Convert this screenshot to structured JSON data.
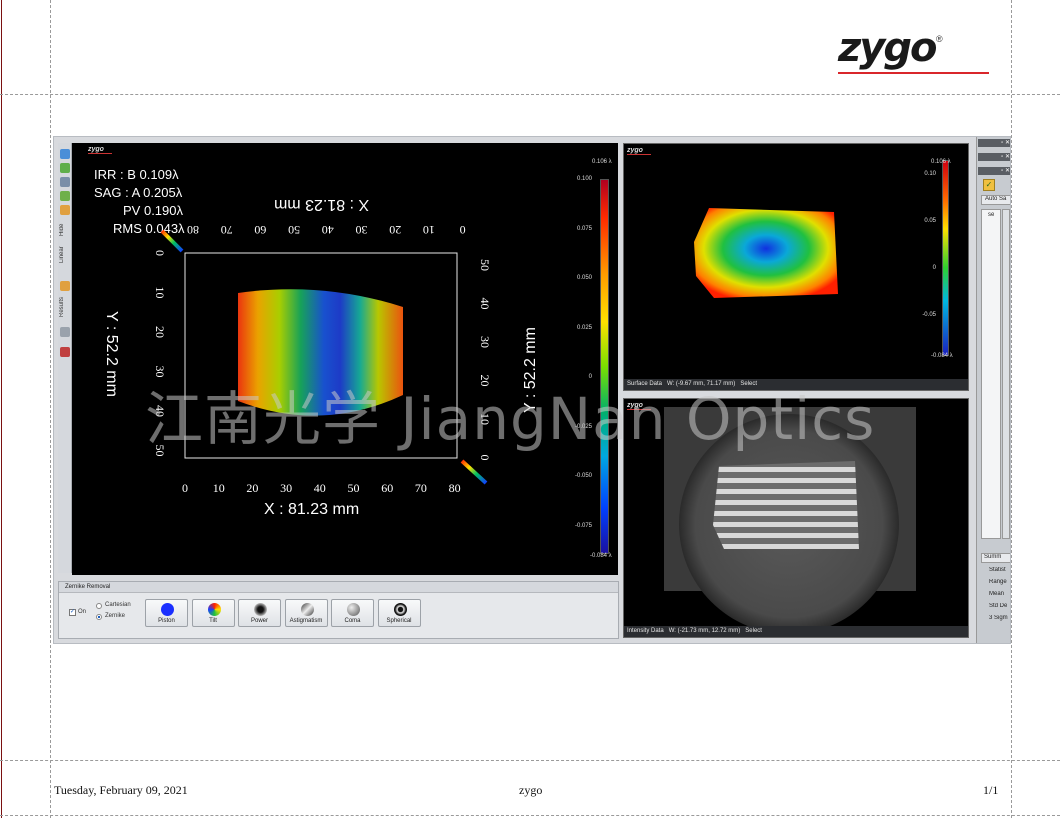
{
  "header": {
    "logo": "zygo",
    "logo_mark": "®",
    "logo_accent": "#d9262b"
  },
  "left_toolbar": {
    "tabs": [
      "Hide",
      "Linear",
      "Results"
    ]
  },
  "main_plot": {
    "mini_logo": "zygo",
    "stats": [
      {
        "label": "IRR : B",
        "value": "0.109λ"
      },
      {
        "label": "SAG : A",
        "value": "0.205λ"
      },
      {
        "label": "PV",
        "value": "0.190λ"
      },
      {
        "label": "RMS",
        "value": "0.043λ"
      }
    ],
    "x_axis_label": "X : 81.23 mm",
    "x_axis_label_mirrored": "X : 81.23 mm",
    "y_axis_label": "Y : 52.2 mm",
    "y_axis_label_right": "Y : 52.2 mm",
    "x_ticks": [
      "0",
      "10",
      "20",
      "30",
      "40",
      "50",
      "60",
      "70",
      "80"
    ],
    "x_ticks_top": [
      "80",
      "70",
      "60",
      "50",
      "40",
      "30",
      "20",
      "10",
      "0"
    ],
    "y_ticks_left": [
      "0",
      "10",
      "20",
      "30",
      "40",
      "50"
    ],
    "y_ticks_right": [
      "50",
      "40",
      "30",
      "20",
      "10",
      "0"
    ],
    "colorbar_top": "0.106 λ",
    "colorbar_bottom": "-0.084 λ",
    "colorbar_ticks": [
      "0.100",
      "0.075",
      "0.050",
      "0.025",
      "0",
      "-0.025",
      "-0.050",
      "-0.075"
    ]
  },
  "zernike_panel": {
    "title": "Zernike Removal",
    "on_label": "On",
    "on_checked": true,
    "mode_options": [
      "Cartesian",
      "Zernike"
    ],
    "mode_selected": "Zernike",
    "terms": [
      {
        "label": "Piston",
        "icon": "piston-icon"
      },
      {
        "label": "Tilt",
        "icon": "tilt-icon"
      },
      {
        "label": "Power",
        "icon": "power-icon"
      },
      {
        "label": "Astigmatism",
        "icon": "astigmatism-icon"
      },
      {
        "label": "Coma",
        "icon": "coma-icon"
      },
      {
        "label": "Spherical",
        "icon": "spherical-icon"
      }
    ]
  },
  "surface_panel": {
    "mini_logo": "zygo",
    "colorbar_top": "0.106 λ",
    "colorbar_bottom": "-0.084 λ",
    "colorbar_ticks": [
      "0.10",
      "0.05",
      "0",
      "-0.05"
    ],
    "status": "Surface Data",
    "cursor": "W: (-9.67 mm, 71.17 mm)",
    "action": "Select"
  },
  "intensity_panel": {
    "mini_logo": "zygo",
    "status": "Intensity Data",
    "cursor": "W: (-21.73 mm, 12.72 mm)",
    "action": "Select"
  },
  "right_dock": {
    "auto_label": "Auto Sa",
    "column_header": "se",
    "summary_tab": "Summ",
    "summary_header": "Statist",
    "summary_rows": [
      "Range",
      "Mean",
      "Std De",
      "3 Sigm"
    ]
  },
  "watermark": "江南光学 JiangNan Optics",
  "footer": {
    "date": "Tuesday, February 09, 2021",
    "center": "zygo",
    "page": "1/1"
  }
}
